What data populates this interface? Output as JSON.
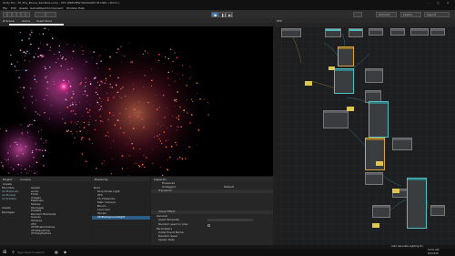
{
  "window": {
    "title": "Unity Pro - FX_Fire_Bonus_Sandbox.unity - VFX [PREVIEW PACKAGES IN USE] <DX11>"
  },
  "menu": [
    "File",
    "Edit",
    "Assets",
    "GameObject",
    "Component",
    "Window",
    "Help"
  ],
  "toolbar": {
    "account": "Account",
    "layers": "Layers",
    "layout": "Layout"
  },
  "scene_tabs": [
    "# Scene",
    "Game",
    "Asset Store"
  ],
  "vfx_tab": "VFX",
  "bottom": {
    "project_tab": "Project",
    "console_tab": "Console",
    "hierarchy_tab": "Hierarchy",
    "inspector_tab": "Inspector",
    "create": "Create",
    "tree": [
      "Favorites",
      "Assets",
      "All Materials",
      "All Models",
      "All Prefabs",
      "Assets",
      "Packages"
    ],
    "files": [
      "Assets",
      "Audio",
      "Fonts",
      "Images",
      "Materials",
      "Models",
      "Packages",
      "Prefabs",
      "Random Elements",
      "Scenes",
      "Spheres",
      "VFX",
      "VFXFirebrimstone",
      "VFXPlaneFlow",
      "VFXSkyParticle",
      "VFXSettlement"
    ],
    "hierarchy": [
      "Root",
      "Directional Light",
      "VFX",
      "FX_Fireworks",
      "Main Camera",
      "Bloom",
      "Launcher",
      "Terrain",
      "VfxBackgroundLight"
    ],
    "inspector": {
      "object": "Fireworks",
      "tag": "Untagged",
      "layer": "Default",
      "transform": "Transform",
      "visual_effect": "Visual Effect",
      "general": "General",
      "asset_template": "Asset Template",
      "random_seed": "Random seed on play",
      "parameters": "Parameters",
      "rows": [
        "Initial Event Name",
        "Random Seed",
        "Spawn Rate",
        "Color",
        "Gravity"
      ]
    },
    "status": "Auto Generate Lighting On"
  },
  "taskbar": {
    "search": "Type here to search",
    "time": "10:51 AM",
    "date": "8/1/2018"
  },
  "colors": {
    "accent": "#4aa3ff",
    "firework_pink": "#ff3fa8",
    "sticky": "#e0c64c",
    "node_teal": "#4fbfc0"
  }
}
